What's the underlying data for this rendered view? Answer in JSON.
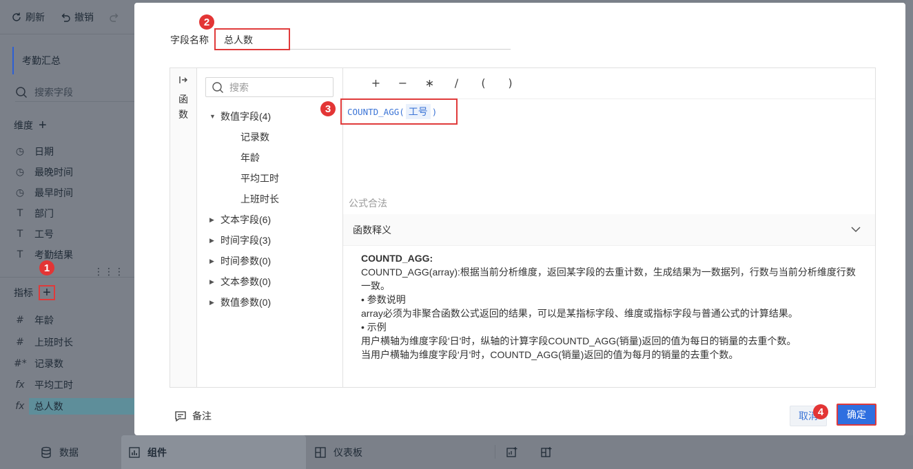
{
  "toolbar": {
    "refresh": "刷新",
    "undo": "撤销"
  },
  "dataset": {
    "name": "考勤汇总"
  },
  "field_search": {
    "placeholder": "搜索字段"
  },
  "dimensions": {
    "title": "维度",
    "items": [
      {
        "icon": "clock-icon",
        "label": "日期"
      },
      {
        "icon": "clock-icon",
        "label": "最晚时间"
      },
      {
        "icon": "clock-icon",
        "label": "最早时间"
      },
      {
        "icon": "text-type-icon",
        "label": "部门"
      },
      {
        "icon": "text-type-icon",
        "label": "工号"
      },
      {
        "icon": "text-type-icon",
        "label": "考勤结果"
      }
    ]
  },
  "metrics": {
    "title": "指标",
    "items": [
      {
        "icon": "hash-icon",
        "label": "年龄"
      },
      {
        "icon": "hash-icon",
        "label": "上班时长"
      },
      {
        "icon": "hash-star-icon",
        "label": "记录数"
      },
      {
        "icon": "fx-icon",
        "label": "平均工时"
      },
      {
        "icon": "fx-icon",
        "label": "总人数"
      }
    ]
  },
  "bottom_tabs": {
    "data": "数据",
    "component": "组件",
    "dashboard": "仪表板"
  },
  "badges": [
    "1",
    "2",
    "3",
    "4"
  ],
  "dialog": {
    "name_label": "字段名称",
    "name_value": "总人数",
    "side_tab": [
      "函",
      "数"
    ],
    "tree_search_placeholder": "搜索",
    "tree": [
      {
        "label": "数值字段(4)",
        "expanded": true,
        "children": [
          "记录数",
          "年龄",
          "平均工时",
          "上班时长"
        ]
      },
      {
        "label": "文本字段(6)",
        "expanded": false
      },
      {
        "label": "时间字段(3)",
        "expanded": false
      },
      {
        "label": "时间参数(0)",
        "expanded": false
      },
      {
        "label": "文本参数(0)",
        "expanded": false
      },
      {
        "label": "数值参数(0)",
        "expanded": false
      }
    ],
    "operators": [
      "+",
      "−",
      "∗",
      "/",
      "(",
      ")"
    ],
    "formula": {
      "func": "COUNTD_AGG(",
      "arg": "工号",
      "close": ")"
    },
    "validation": "公式合法",
    "definition_header": "函数释义",
    "definition": {
      "name": "COUNTD_AGG:",
      "lines": [
        "COUNTD_AGG(array):根据当前分析维度，返回某字段的去重计数，生成结果为一数据列，行数与当前分析维度行数一致。",
        "• 参数说明",
        "array必须为非聚合函数公式返回的结果，可以是某指标字段、维度或指标字段与普通公式的计算结果。",
        "• 示例",
        "用户横轴为维度字段'日'时，纵轴的计算字段COUNTD_AGG(销量)返回的值为每日的销量的去重个数。",
        "当用户横轴为维度字段'月'时，COUNTD_AGG(销量)返回的值为每月的销量的去重个数。"
      ]
    },
    "remark": "备注",
    "cancel": "取消",
    "ok": "确定"
  },
  "colors": {
    "accent": "#2f6fe0",
    "highlight_red": "#e03a3a",
    "formula_blue": "#3b74d6"
  }
}
